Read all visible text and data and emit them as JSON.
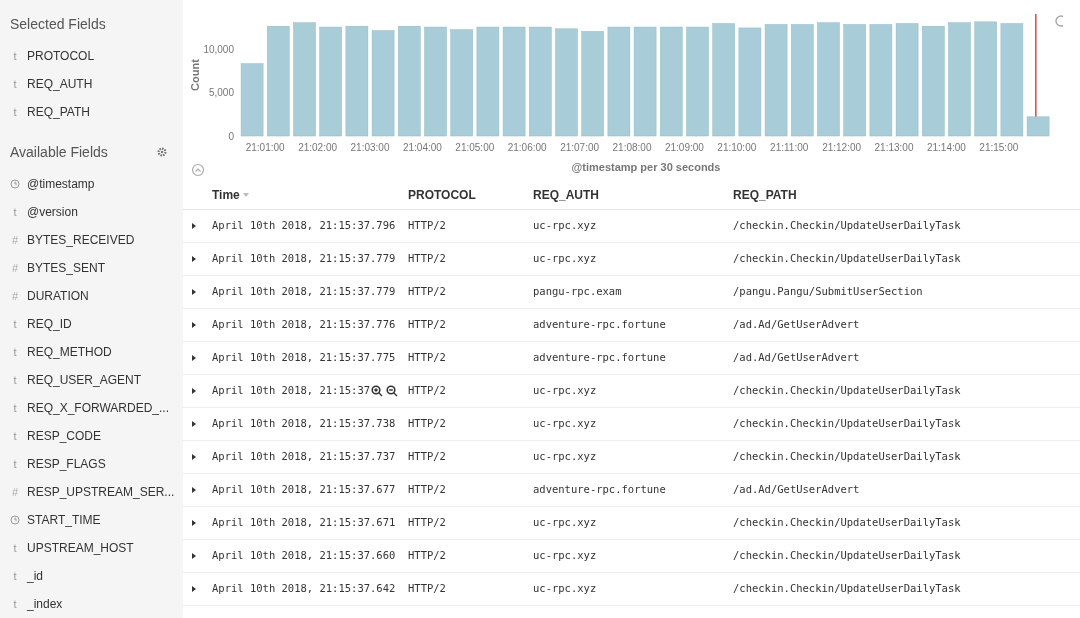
{
  "sidebar": {
    "selected_title": "Selected Fields",
    "selected_fields": [
      {
        "kind": "text",
        "symbol": "t",
        "name": "PROTOCOL"
      },
      {
        "kind": "text",
        "symbol": "t",
        "name": "REQ_AUTH"
      },
      {
        "kind": "text",
        "symbol": "t",
        "name": "REQ_PATH"
      }
    ],
    "available_title": "Available Fields",
    "available_fields": [
      {
        "kind": "date",
        "name": "@timestamp"
      },
      {
        "kind": "text",
        "symbol": "t",
        "name": "@version"
      },
      {
        "kind": "number",
        "symbol": "#",
        "name": "BYTES_RECEIVED"
      },
      {
        "kind": "number",
        "symbol": "#",
        "name": "BYTES_SENT"
      },
      {
        "kind": "number",
        "symbol": "#",
        "name": "DURATION"
      },
      {
        "kind": "text",
        "symbol": "t",
        "name": "REQ_ID"
      },
      {
        "kind": "text",
        "symbol": "t",
        "name": "REQ_METHOD"
      },
      {
        "kind": "text",
        "symbol": "t",
        "name": "REQ_USER_AGENT"
      },
      {
        "kind": "text",
        "symbol": "t",
        "name": "REQ_X_FORWARDED_..."
      },
      {
        "kind": "text",
        "symbol": "t",
        "name": "RESP_CODE"
      },
      {
        "kind": "text",
        "symbol": "t",
        "name": "RESP_FLAGS"
      },
      {
        "kind": "number",
        "symbol": "#",
        "name": "RESP_UPSTREAM_SER..."
      },
      {
        "kind": "date",
        "name": "START_TIME"
      },
      {
        "kind": "text",
        "symbol": "t",
        "name": "UPSTREAM_HOST"
      },
      {
        "kind": "text",
        "symbol": "t",
        "name": "_id"
      },
      {
        "kind": "text",
        "symbol": "t",
        "name": "_index"
      }
    ]
  },
  "histogram": {
    "chart_data": {
      "type": "bar",
      "xlabel": "@timestamp per 30 seconds",
      "ylabel": "Count",
      "categories": [
        null,
        "21:01:00",
        null,
        "21:02:00",
        null,
        "21:03:00",
        null,
        "21:04:00",
        null,
        "21:05:00",
        null,
        "21:06:00",
        null,
        "21:07:00",
        null,
        "21:08:00",
        null,
        "21:09:00",
        null,
        "21:10:00",
        null,
        "21:11:00",
        null,
        "21:12:00",
        null,
        "21:13:00",
        null,
        "21:14:00",
        null,
        "21:15:00",
        null
      ],
      "series": [
        {
          "color": "#a9cdd8",
          "values": [
            8300,
            12600,
            13000,
            12500,
            12600,
            12100,
            12600,
            12500,
            12200,
            12500,
            12500,
            12500,
            12300,
            12000,
            12500,
            12500,
            12500,
            12500,
            12900,
            12400,
            12800,
            12800,
            13000,
            12800,
            12800,
            12900,
            12600,
            13000,
            13100,
            12900,
            2200
          ]
        }
      ],
      "ylim": [
        0,
        14000
      ],
      "yticks": [
        {
          "value": 0,
          "label": "0"
        },
        {
          "value": 5000,
          "label": "5,000"
        },
        {
          "value": 10000,
          "label": "10,000"
        }
      ]
    }
  },
  "table": {
    "columns": [
      {
        "label": "Time",
        "sorted": true
      },
      {
        "label": "PROTOCOL",
        "sorted": false
      },
      {
        "label": "REQ_AUTH",
        "sorted": false
      },
      {
        "label": "REQ_PATH",
        "sorted": false
      }
    ],
    "rows": [
      {
        "time": "April 10th 2018, 21:15:37.796",
        "protocol": "HTTP/2",
        "req_auth": "uc-rpc.xyz",
        "req_path": "/checkin.Checkin/UpdateUserDailyTask",
        "hovered": false
      },
      {
        "time": "April 10th 2018, 21:15:37.779",
        "protocol": "HTTP/2",
        "req_auth": "uc-rpc.xyz",
        "req_path": "/checkin.Checkin/UpdateUserDailyTask",
        "hovered": false
      },
      {
        "time": "April 10th 2018, 21:15:37.779",
        "protocol": "HTTP/2",
        "req_auth": "pangu-rpc.exam",
        "req_path": "/pangu.Pangu/SubmitUserSection",
        "hovered": false
      },
      {
        "time": "April 10th 2018, 21:15:37.776",
        "protocol": "HTTP/2",
        "req_auth": "adventure-rpc.fortune",
        "req_path": "/ad.Ad/GetUserAdvert",
        "hovered": false
      },
      {
        "time": "April 10th 2018, 21:15:37.775",
        "protocol": "HTTP/2",
        "req_auth": "adventure-rpc.fortune",
        "req_path": "/ad.Ad/GetUserAdvert",
        "hovered": false
      },
      {
        "time": "April 10th 2018, 21:15:37",
        "protocol": "HTTP/2",
        "req_auth": "uc-rpc.xyz",
        "req_path": "/checkin.Checkin/UpdateUserDailyTask",
        "hovered": true
      },
      {
        "time": "April 10th 2018, 21:15:37.738",
        "protocol": "HTTP/2",
        "req_auth": "uc-rpc.xyz",
        "req_path": "/checkin.Checkin/UpdateUserDailyTask",
        "hovered": false
      },
      {
        "time": "April 10th 2018, 21:15:37.737",
        "protocol": "HTTP/2",
        "req_auth": "uc-rpc.xyz",
        "req_path": "/checkin.Checkin/UpdateUserDailyTask",
        "hovered": false
      },
      {
        "time": "April 10th 2018, 21:15:37.677",
        "protocol": "HTTP/2",
        "req_auth": "adventure-rpc.fortune",
        "req_path": "/ad.Ad/GetUserAdvert",
        "hovered": false
      },
      {
        "time": "April 10th 2018, 21:15:37.671",
        "protocol": "HTTP/2",
        "req_auth": "uc-rpc.xyz",
        "req_path": "/checkin.Checkin/UpdateUserDailyTask",
        "hovered": false
      },
      {
        "time": "April 10th 2018, 21:15:37.660",
        "protocol": "HTTP/2",
        "req_auth": "uc-rpc.xyz",
        "req_path": "/checkin.Checkin/UpdateUserDailyTask",
        "hovered": false
      },
      {
        "time": "April 10th 2018, 21:15:37.642",
        "protocol": "HTTP/2",
        "req_auth": "uc-rpc.xyz",
        "req_path": "/checkin.Checkin/UpdateUserDailyTask",
        "hovered": false
      }
    ]
  }
}
